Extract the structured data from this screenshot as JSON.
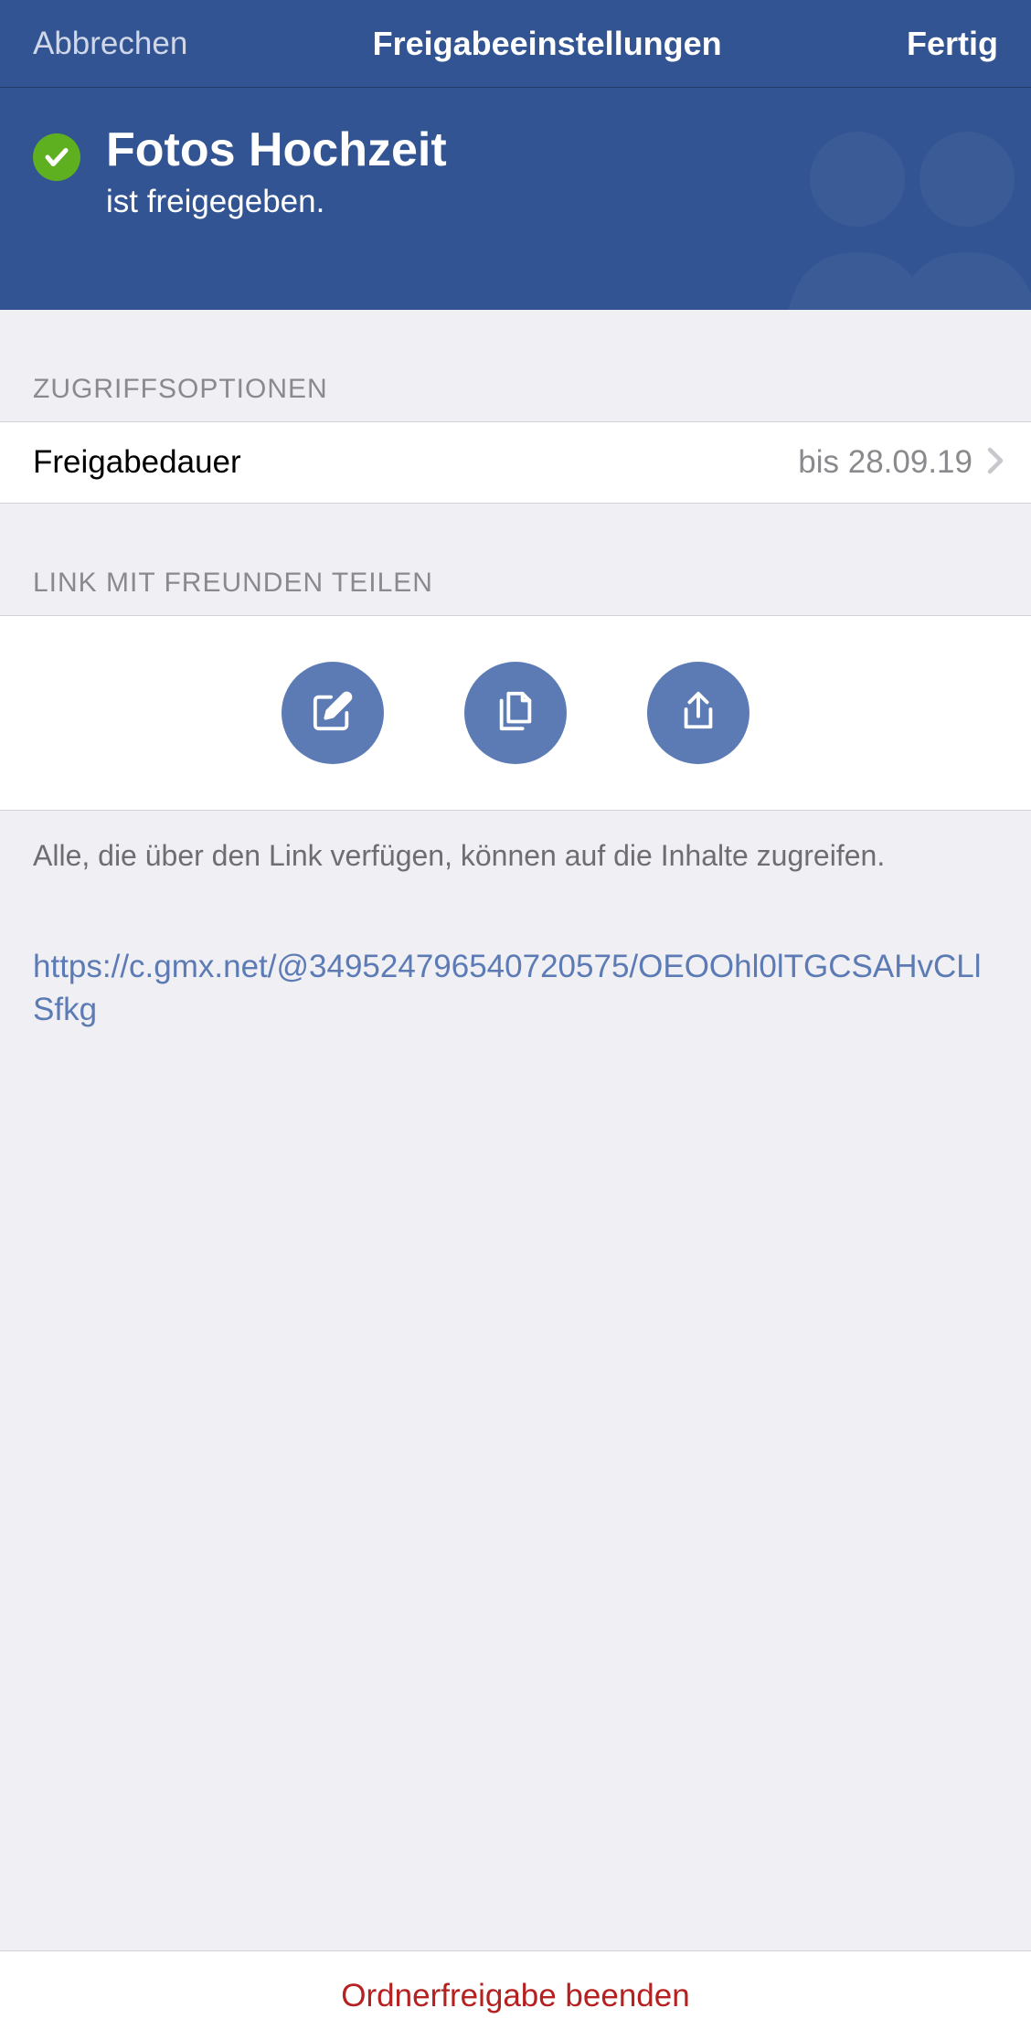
{
  "navbar": {
    "cancel": "Abbrechen",
    "title": "Freigabeeinstellungen",
    "done": "Fertig"
  },
  "hero": {
    "title": "Fotos Hochzeit",
    "subtitle": "ist freigegeben."
  },
  "sections": {
    "access_options_header": "ZUGRIFFSOPTIONEN",
    "share_link_header": "LINK MIT FREUNDEN TEILEN"
  },
  "access": {
    "duration_label": "Freigabedauer",
    "duration_value": "bis 28.09.19"
  },
  "share": {
    "info": "Alle, die über den Link verfügen, können auf die Inhalte zugreifen.",
    "url": "https://c.gmx.net/@349524796540720575/OEOOhl0lTGCSAHvCLlSfkg"
  },
  "footer": {
    "stop_sharing": "Ordnerfreigabe beenden"
  }
}
